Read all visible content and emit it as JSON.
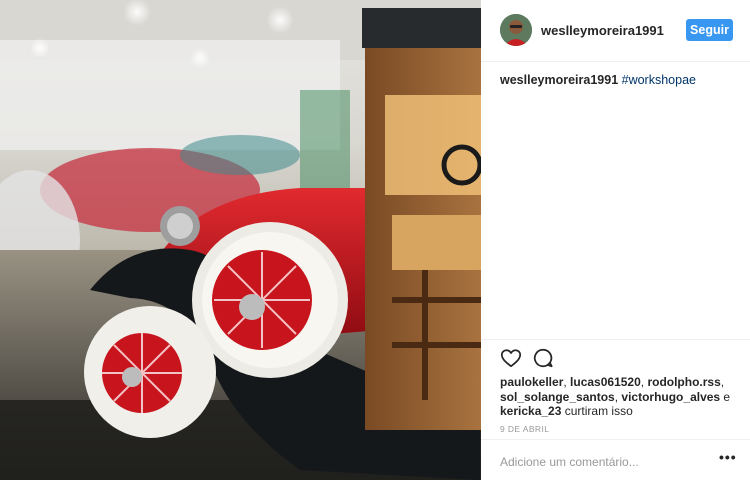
{
  "post": {
    "photo_alt": "red vintage toy car",
    "author": "weslleymoreira1991",
    "follow_label": "Seguir",
    "caption": {
      "user": "weslleymoreira1991",
      "hashtag": "#workshopae"
    },
    "likes": {
      "users": [
        "paulokeller",
        "lucas061520",
        "rodolpho.rss",
        "sol_solange_santos",
        "victorhugo_alves"
      ],
      "sep1": ", ",
      "sep_last": " e ",
      "last_user": "kericka_23",
      "suffix": " curtiram isso"
    },
    "date": "9 DE ABRIL",
    "comment_placeholder": "Adicione um comentário...",
    "more_label": "•••"
  },
  "icons": {
    "like": "heart-icon",
    "comment": "comment-bubble-icon",
    "more": "more-options-icon"
  },
  "colors": {
    "accent": "#3897f0",
    "hashtag": "#003569",
    "car_red": "#c8141c"
  }
}
